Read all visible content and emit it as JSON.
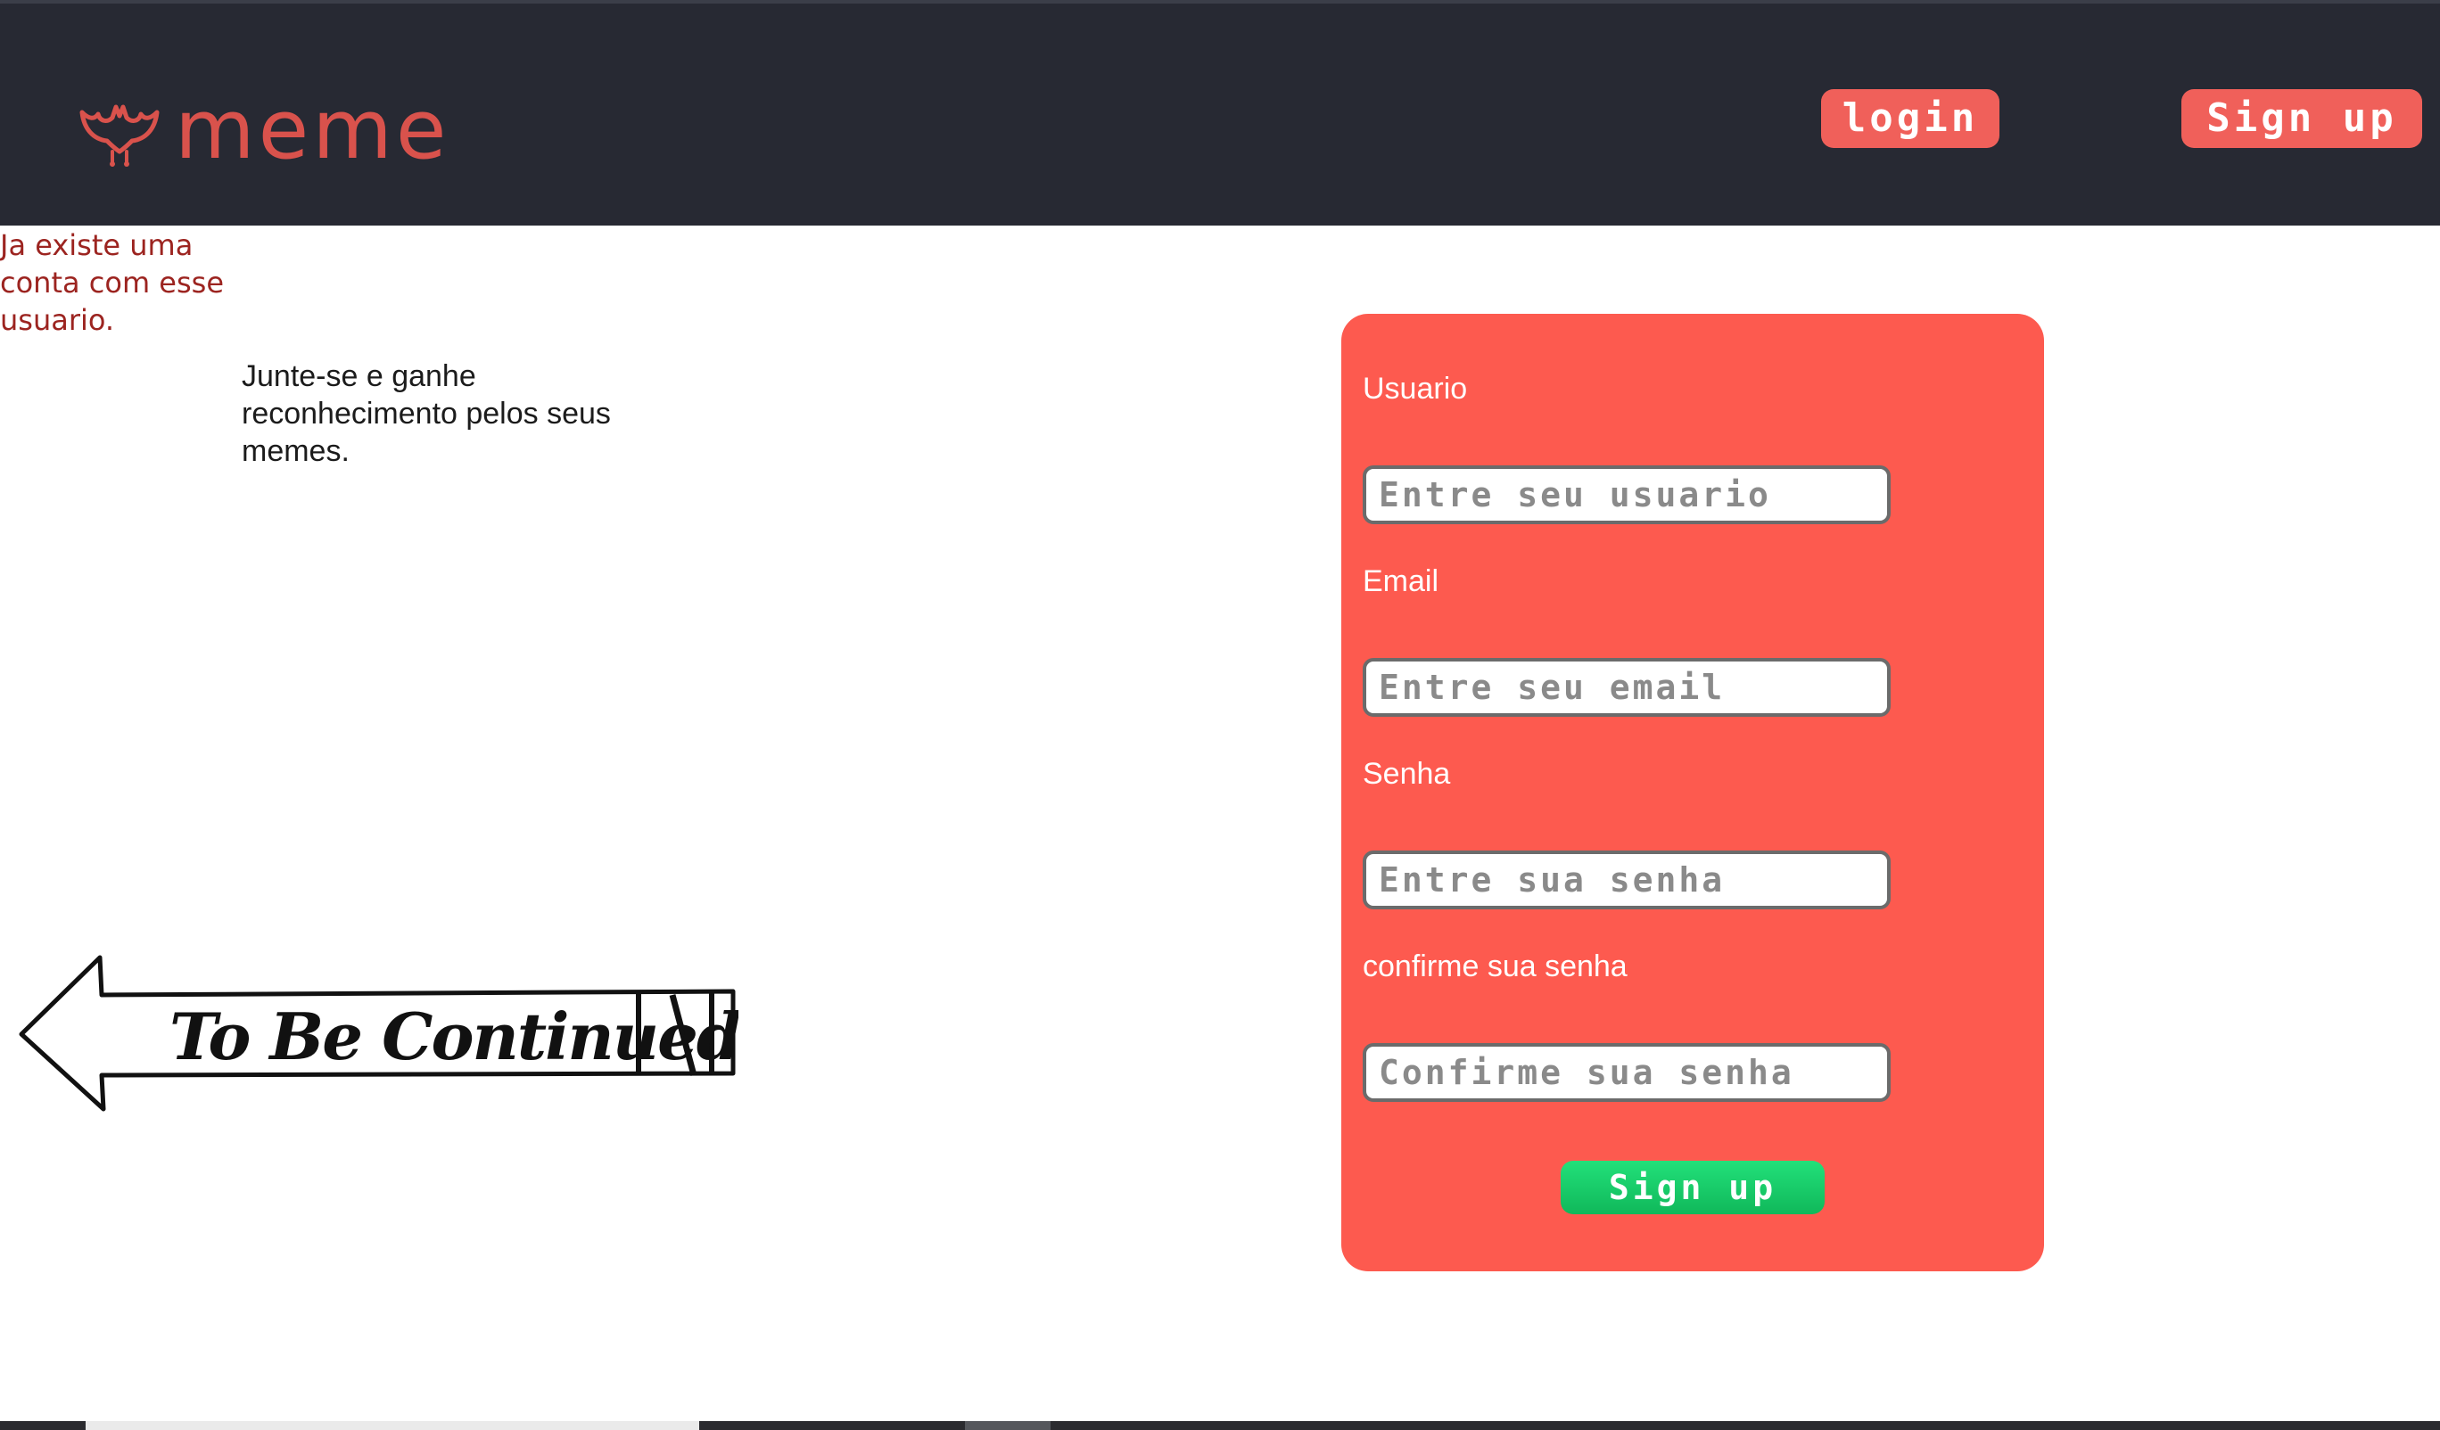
{
  "header": {
    "logo_text": "meme",
    "login_label": "login",
    "signup_label": "Sign up"
  },
  "error_message": "Ja existe uma conta com esse usuario.",
  "tagline": "Junte-se e ganhe reconhecimento pelos seus memes.",
  "illustration": {
    "text": "To Be Continued"
  },
  "form": {
    "username_label": "Usuario",
    "username_placeholder": "Entre seu usuario",
    "email_label": "Email",
    "email_placeholder": "Entre seu email",
    "password_label": "Senha",
    "password_placeholder": "Entre sua senha",
    "confirm_label": "confirme sua senha",
    "confirm_placeholder": "Confirme sua senha",
    "submit_label": "Sign up"
  },
  "colors": {
    "header_bg": "#272933",
    "brand_red": "#d9524c",
    "card_bg": "#fd5a4f",
    "submit_green": "#16c864",
    "error_text": "#9c2420"
  },
  "icons": {
    "logo": "bat-icon",
    "tbc": "arrow-left-icon"
  }
}
